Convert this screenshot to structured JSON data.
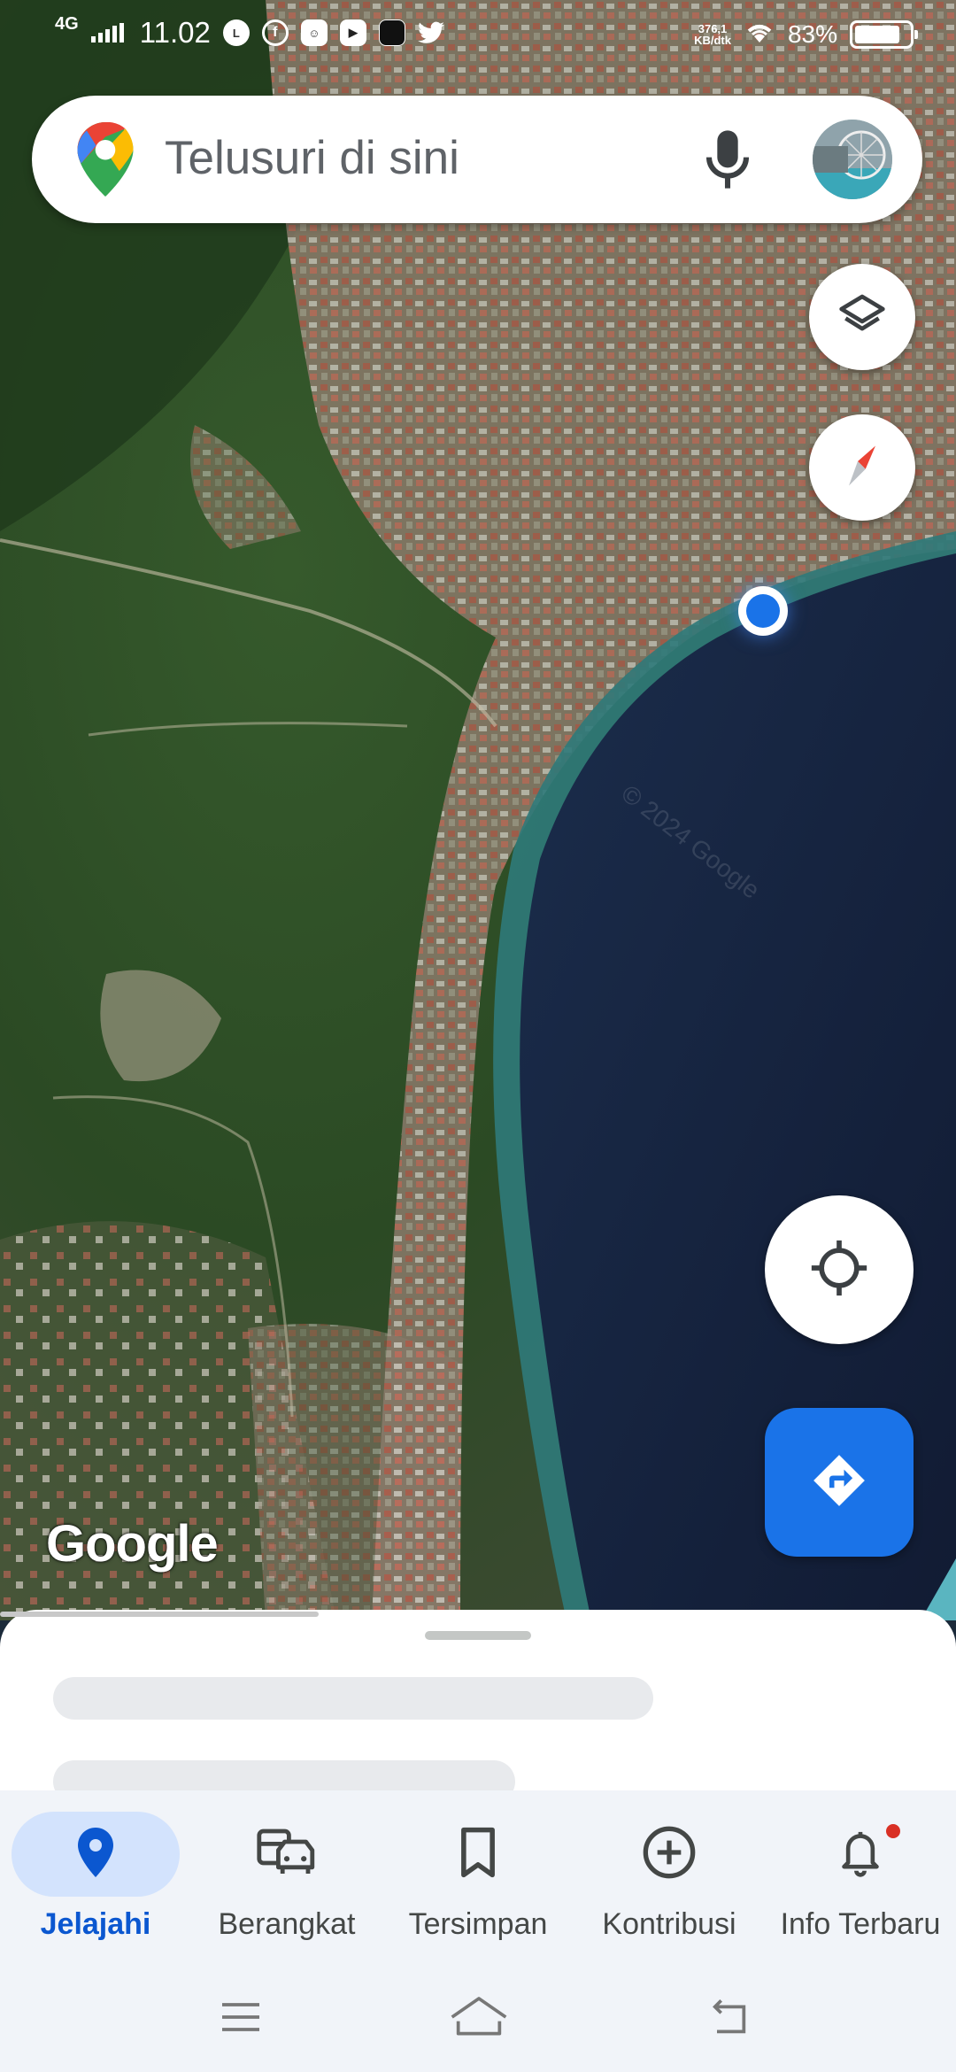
{
  "status_bar": {
    "network": "4G",
    "time": "11.02",
    "speed_value": "376,1",
    "speed_unit": "KB/dtk",
    "battery": "83%",
    "battery_level": 0.83
  },
  "search": {
    "placeholder": "Telusuri di sini"
  },
  "map": {
    "watermark": "Google",
    "view": "satellite",
    "copyright": "© 2024 Google"
  },
  "bottom_nav": {
    "items": [
      {
        "label": "Jelajahi",
        "icon": "explore-pin-icon",
        "active": true
      },
      {
        "label": "Berangkat",
        "icon": "commute-icon",
        "active": false
      },
      {
        "label": "Tersimpan",
        "icon": "bookmark-icon",
        "active": false
      },
      {
        "label": "Kontribusi",
        "icon": "add-circle-icon",
        "active": false
      },
      {
        "label": "Info Terbaru",
        "icon": "bell-icon",
        "active": false
      }
    ]
  },
  "colors": {
    "accent": "#1a73e8",
    "active_pill": "#d3e3fd",
    "sea": "#14223c",
    "land": "#2e4a2a"
  }
}
